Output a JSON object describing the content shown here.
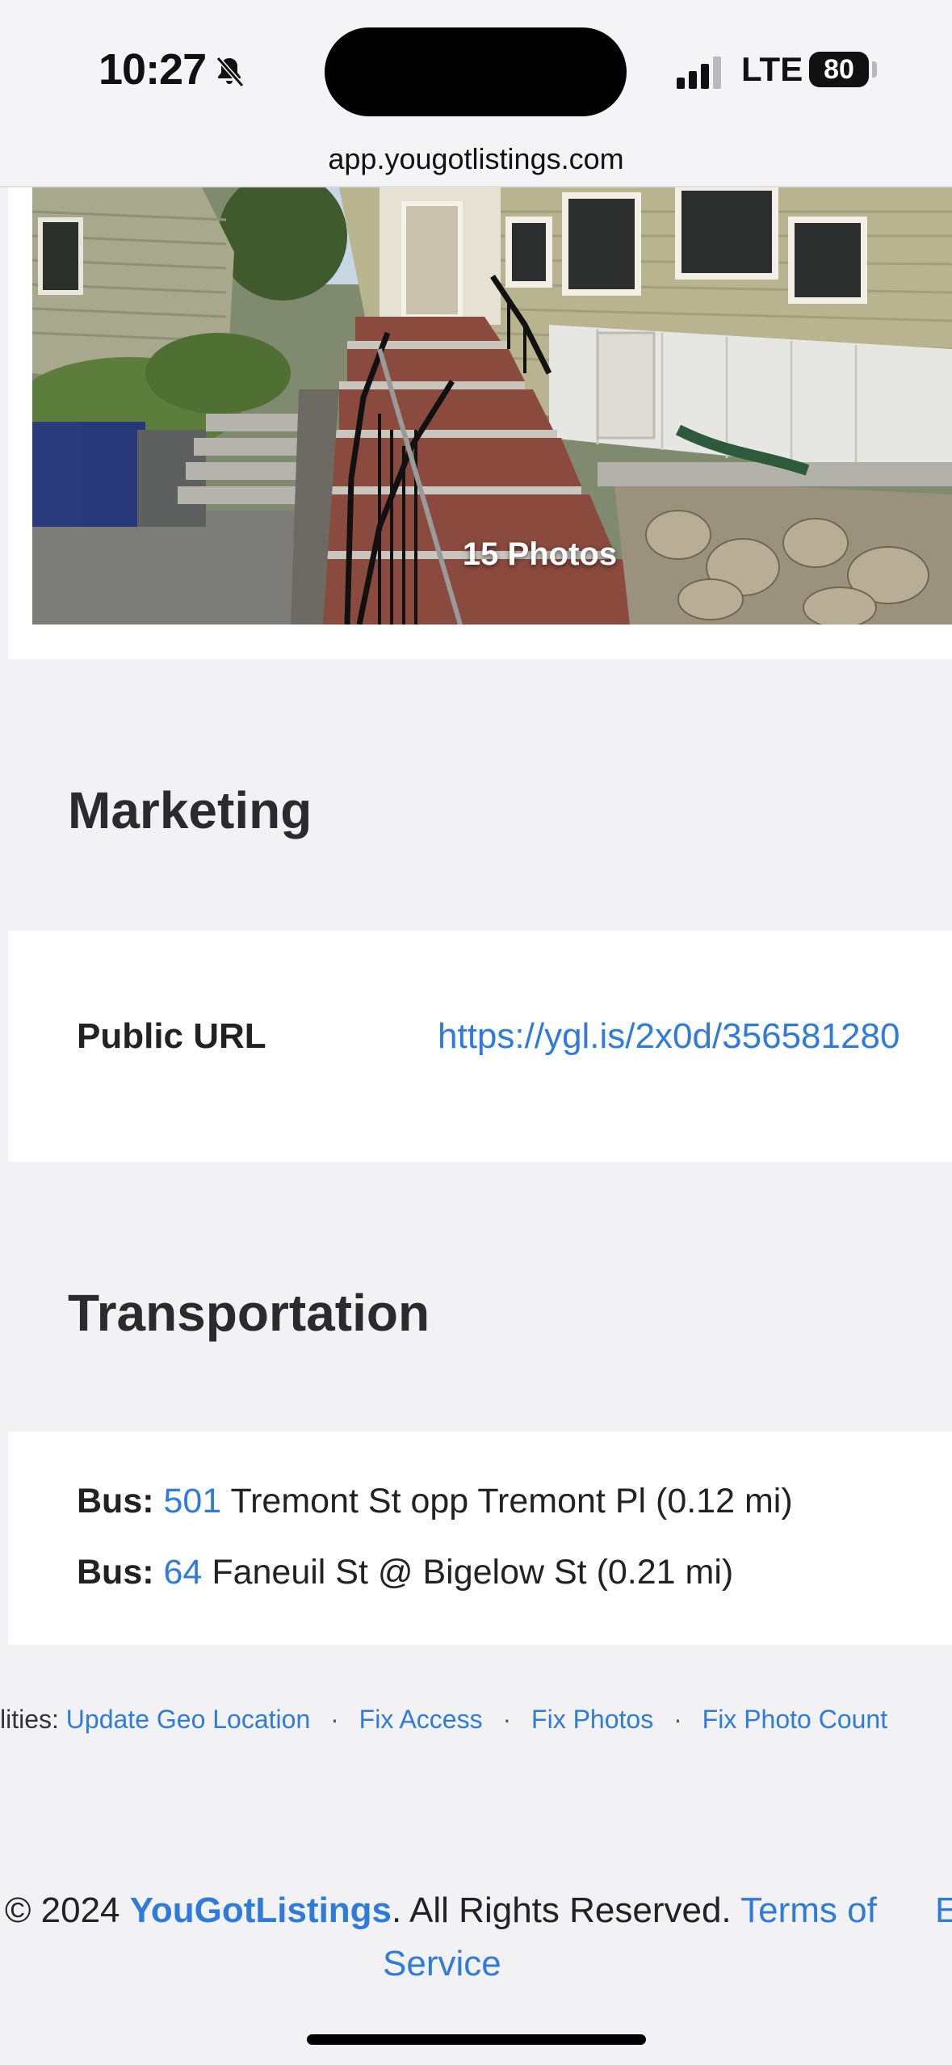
{
  "status_bar": {
    "time": "10:27",
    "network": "LTE",
    "battery": "80",
    "url": "app.yougotlistings.com"
  },
  "photo": {
    "count_label": "15 Photos"
  },
  "marketing": {
    "title": "Marketing",
    "public_url_label": "Public URL",
    "public_url_value": "https://ygl.is/2x0d/356581280"
  },
  "transportation": {
    "title": "Transportation",
    "stops": [
      {
        "type": "Bus:",
        "route": "501",
        "description": "Tremont St opp Tremont Pl (0.12 mi)"
      },
      {
        "type": "Bus:",
        "route": "64",
        "description": "Faneuil St @ Bigelow St (0.21 mi)"
      }
    ]
  },
  "utilities": {
    "prefix": "lities:",
    "links": [
      "Update Geo Location",
      "Fix Access",
      "Fix Photos",
      "Fix Photo Count"
    ],
    "separator": "·"
  },
  "footer": {
    "copyright": "© 2024",
    "brand": "YouGotListings",
    "rights": ". All Rights Reserved.",
    "terms_part1": "Terms of",
    "terms_part2": "Service",
    "edge_char": "E"
  },
  "colors": {
    "link": "#2f7bdc",
    "background": "#f2f2f4",
    "card": "#ffffff"
  }
}
